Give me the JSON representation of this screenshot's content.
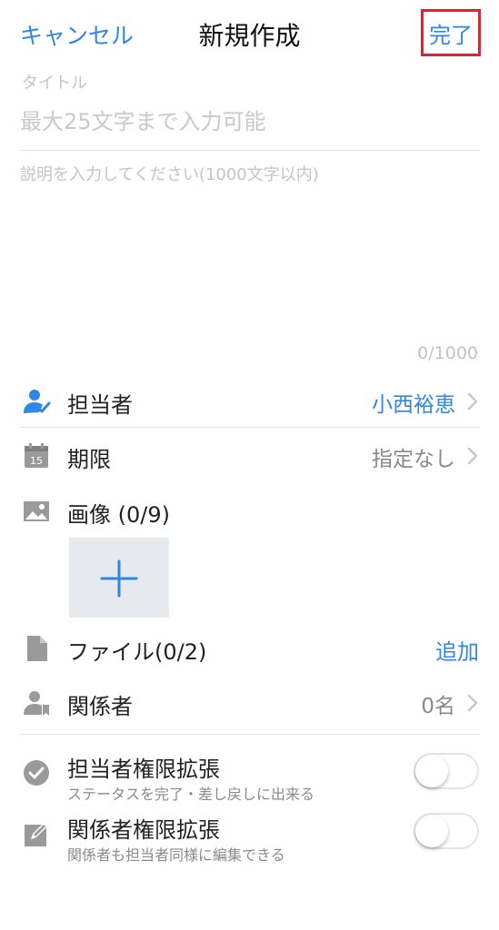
{
  "header": {
    "cancel_label": "キャンセル",
    "title": "新規作成",
    "done_label": "完了"
  },
  "title_field": {
    "label": "タイトル",
    "placeholder": "最大25文字まで入力可能",
    "value": ""
  },
  "description_field": {
    "placeholder": "説明を入力してください(1000文字以内)",
    "value": "",
    "counter": "0/1000"
  },
  "assignee": {
    "label": "担当者",
    "value": "小西裕恵",
    "icon": "person-check-icon"
  },
  "deadline": {
    "label": "期限",
    "value": "指定なし",
    "icon": "calendar-icon",
    "icon_text": "15"
  },
  "images": {
    "label": "画像 (0/9)",
    "icon": "image-icon"
  },
  "files": {
    "label": "ファイル(0/2)",
    "add_label": "追加",
    "icon": "file-icon"
  },
  "related": {
    "label": "関係者",
    "value": "0名",
    "icon": "person-bookmark-icon"
  },
  "permissions": [
    {
      "label": "担当者権限拡張",
      "sub": "ステータスを完了・差し戻しに出来る",
      "icon": "check-circle-icon",
      "enabled": false
    },
    {
      "label": "関係者権限拡張",
      "sub": "関係者も担当者同様に編集できる",
      "icon": "edit-icon",
      "enabled": false
    }
  ],
  "colors": {
    "accent": "#2f86e5",
    "highlight_border": "#d9262c",
    "icon_gray": "#9a9a9a"
  }
}
